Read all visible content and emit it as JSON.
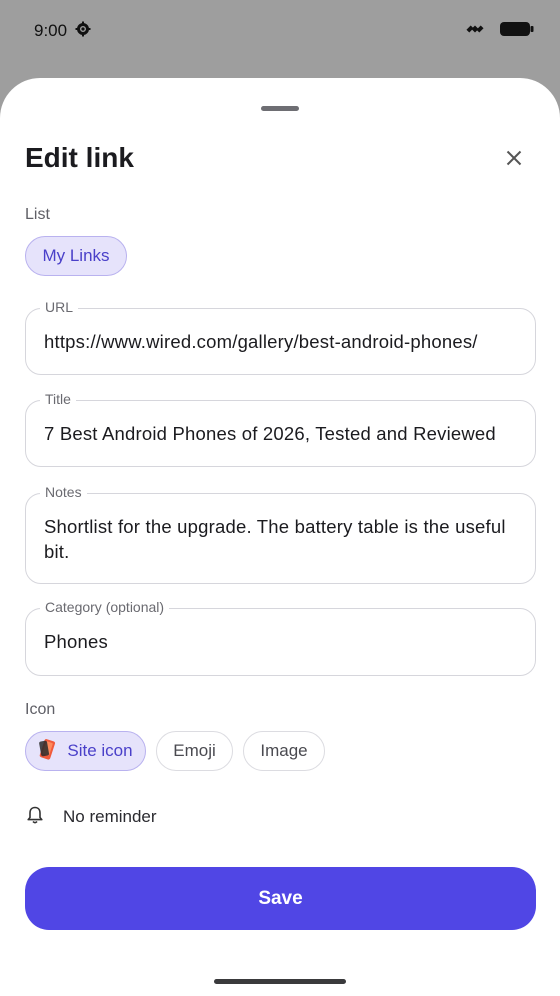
{
  "status_bar": {
    "time": "9:00"
  },
  "sheet": {
    "title": "Edit link",
    "list": {
      "label": "List",
      "selected": "My Links"
    },
    "fields": {
      "url": {
        "label": "URL",
        "value": "https://www.wired.com/gallery/best-android-phones/"
      },
      "title": {
        "label": "Title",
        "value": "7 Best Android Phones of 2026, Tested and Reviewed"
      },
      "notes": {
        "label": "Notes",
        "value": "Shortlist for the upgrade. The battery table is the useful bit."
      },
      "category": {
        "label": "Category (optional)",
        "value": "Phones"
      }
    },
    "icon": {
      "label": "Icon",
      "options": [
        "Site icon",
        "Emoji",
        "Image"
      ],
      "selected": "Site icon"
    },
    "reminder": {
      "label": "No reminder"
    },
    "save_label": "Save"
  },
  "colors": {
    "accent": "#5046e5",
    "chip_selected_bg": "#e6e3fb",
    "chip_selected_text": "#4a40c9",
    "scrim": "#9e9e9e"
  },
  "icons": [
    "settings-gear-icon",
    "satellite-icon",
    "battery-icon",
    "close-icon",
    "site-favicon-icon",
    "bell-icon"
  ]
}
